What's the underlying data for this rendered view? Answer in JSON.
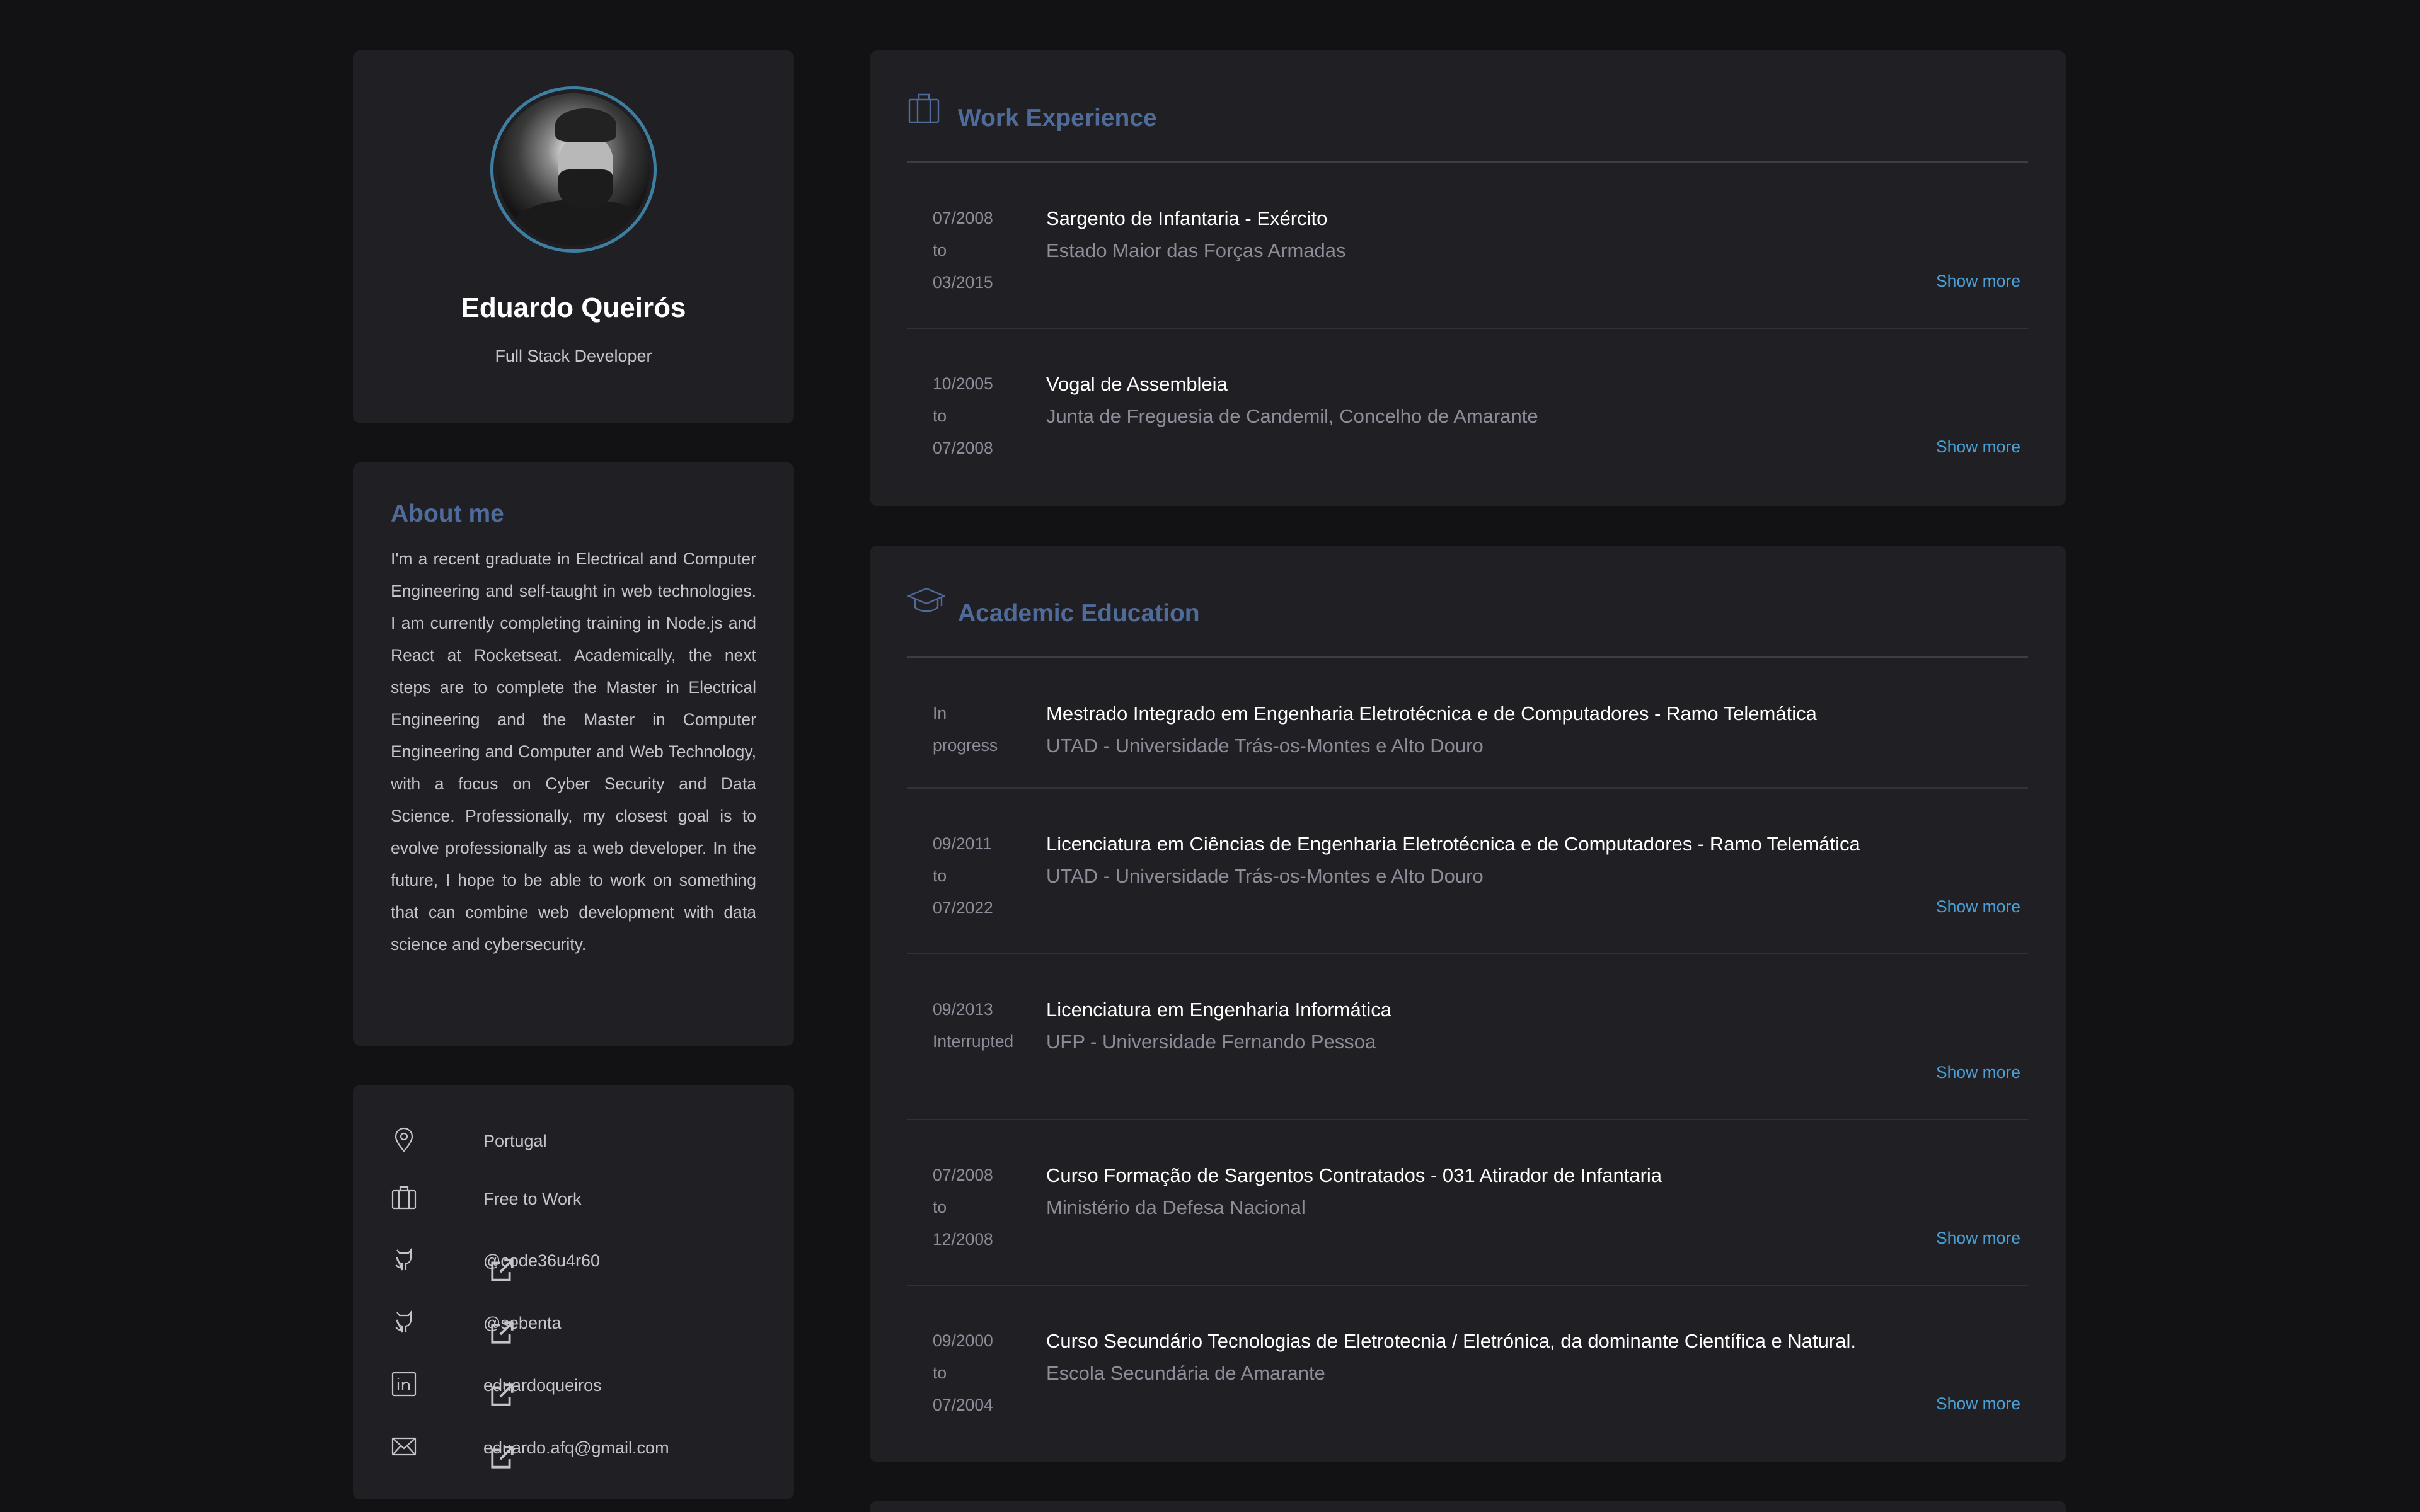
{
  "profile": {
    "name": "Eduardo Queirós",
    "role": "Full Stack Developer"
  },
  "about": {
    "title": "About me",
    "text": "I'm a recent graduate in Electrical and Computer Engineering and self-taught in web technologies. I am currently completing training in Node.js and React at Rocketseat. Academically, the next steps are to complete the Master in Electrical Engineering and the Master in Computer Engineering and Computer and Web Technology, with a focus on Cyber Security and Data Science. Professionally, my closest goal is to evolve professionally as a web developer. In the future, I hope to be able to work on something that can combine web development with data science and cybersecurity."
  },
  "contact": {
    "location": "Portugal",
    "status": "Free to Work",
    "github1": "@code36u4r60",
    "github2": "@sebenta",
    "linkedin": "eduardoqueiros",
    "email": "eduardo.afq@gmail.com"
  },
  "work": {
    "title": "Work Experience",
    "show_more": "Show more",
    "items": [
      {
        "date1": "07/2008",
        "date2": "to",
        "date3": "03/2015",
        "title": "Sargento de Infantaria - Exército",
        "org": "Estado Maior das Forças Armadas"
      },
      {
        "date1": "10/2005",
        "date2": "to",
        "date3": "07/2008",
        "title": "Vogal de Assembleia",
        "org": "Junta de Freguesia de Candemil, Concelho de Amarante"
      }
    ]
  },
  "education": {
    "title": "Academic Education",
    "show_more": "Show more",
    "items": [
      {
        "date1": "In",
        "date2": "progress",
        "date3": "",
        "title": "Mestrado Integrado em Engenharia Eletrotécnica e de Computadores - Ramo Telemática",
        "org": "UTAD - Universidade Trás-os-Montes e Alto Douro"
      },
      {
        "date1": "09/2011",
        "date2": "to",
        "date3": "07/2022",
        "title": "Licenciatura em Ciências de Engenharia Eletrotécnica e de Computadores - Ramo Telemática",
        "org": "UTAD - Universidade Trás-os-Montes e Alto Douro"
      },
      {
        "date1": "09/2013",
        "date2": "Interrupted",
        "date3": "",
        "title": "Licenciatura em Engenharia Informática",
        "org": "UFP - Universidade Fernando Pessoa"
      },
      {
        "date1": "07/2008",
        "date2": "to",
        "date3": "12/2008",
        "title": "Curso Formação de Sargentos Contratados - 031 Atirador de Infantaria",
        "org": "Ministério da Defesa Nacional"
      },
      {
        "date1": "09/2000",
        "date2": "to",
        "date3": "07/2004",
        "title": "Curso Secundário Tecnologias de Eletrotecnia / Eletrónica, da dominante Científica e Natural.",
        "org": "Escola Secundária de Amarante"
      }
    ]
  }
}
